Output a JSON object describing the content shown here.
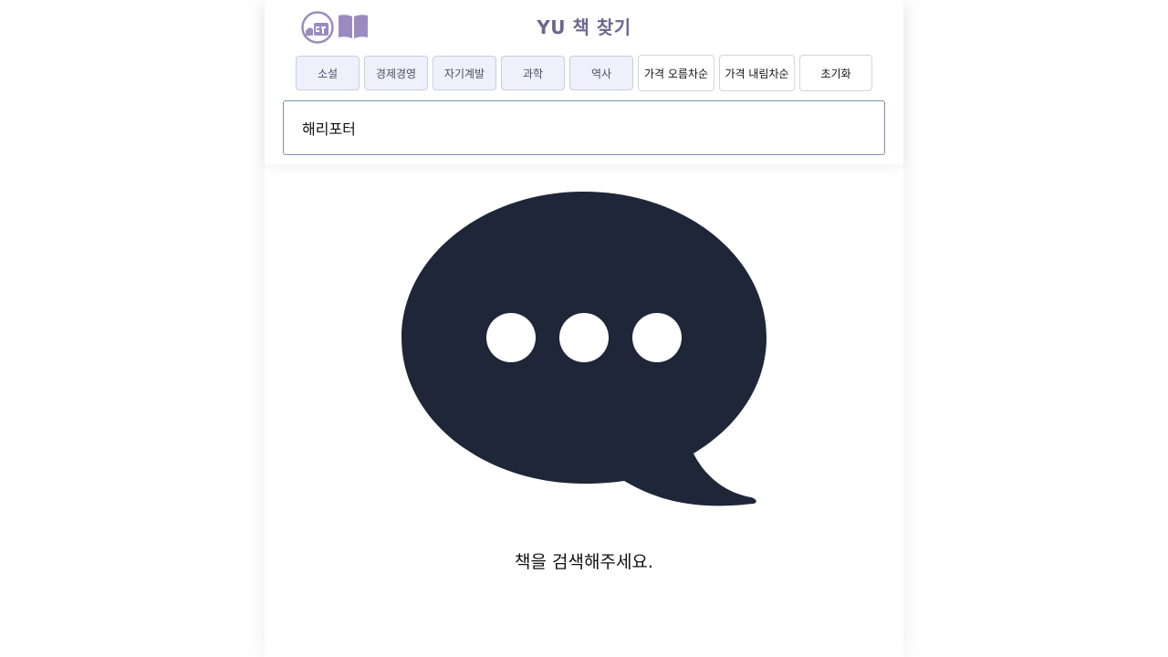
{
  "header": {
    "title": "YU 책 찾기",
    "logo_icon": "university-seal-icon",
    "book_icon": "open-book-icon",
    "accent_color": "#9a8bbf"
  },
  "filters": {
    "categories": [
      "소설",
      "경제경영",
      "자기계발",
      "과학",
      "역사"
    ],
    "sort_asc": "가격 오름차순",
    "sort_desc": "가격 내림차순",
    "reset": "초기화"
  },
  "search": {
    "value": "해리포터"
  },
  "empty_state": {
    "icon": "speech-bubble-ellipsis-icon",
    "message": "책을 검색해주세요.",
    "icon_color": "#1e2638"
  }
}
